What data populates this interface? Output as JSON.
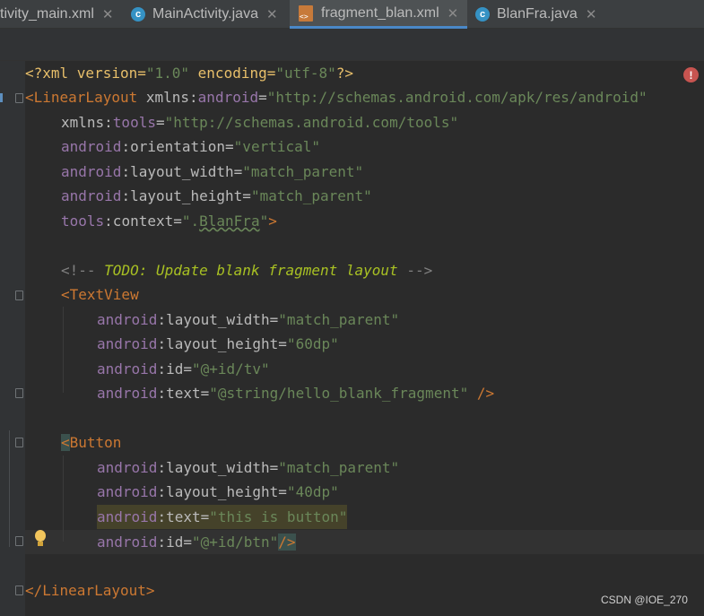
{
  "tabs": [
    {
      "label": "tivity_main.xml",
      "type": "xml",
      "active": false
    },
    {
      "label": "MainActivity.java",
      "type": "java",
      "active": false
    },
    {
      "label": "fragment_blan.xml",
      "type": "xml",
      "active": true
    },
    {
      "label": "BlanFra.java",
      "type": "java",
      "active": false
    }
  ],
  "tab_close_glyph": "✕",
  "java_icon_letter": "c",
  "code": {
    "l1": {
      "a": "<?xml version=",
      "b": "\"1.0\"",
      "c": " encoding=",
      "d": "\"utf-8\"",
      "e": "?>"
    },
    "l2": {
      "a": "<LinearLayout",
      "b": " xmlns:",
      "c": "android",
      "d": "=",
      "e": "\"http://schemas.android.com/apk/res/android\""
    },
    "l3": {
      "a": "xmlns:",
      "b": "tools",
      "c": "=",
      "d": "\"http://schemas.android.com/tools\""
    },
    "l4": {
      "a": "android",
      "b": ":orientation=",
      "c": "\"vertical\""
    },
    "l5": {
      "a": "android",
      "b": ":layout_width=",
      "c": "\"match_parent\""
    },
    "l6": {
      "a": "android",
      "b": ":layout_height=",
      "c": "\"match_parent\""
    },
    "l7": {
      "a": "tools",
      "b": ":context=",
      "c": "\".",
      "d": "BlanFra",
      "e": "\"",
      "f": ">"
    },
    "l9": {
      "a": "<!-- ",
      "b": "TODO: Update blank fragment layout",
      "c": " -->"
    },
    "l10": {
      "a": "<TextView"
    },
    "l11": {
      "a": "android",
      "b": ":layout_width=",
      "c": "\"match_parent\""
    },
    "l12": {
      "a": "android",
      "b": ":layout_height=",
      "c": "\"60dp\""
    },
    "l13": {
      "a": "android",
      "b": ":id=",
      "c": "\"@+id/tv\""
    },
    "l14": {
      "a": "android",
      "b": ":text=",
      "c": "\"@string/hello_blank_fragment\"",
      "d": " />"
    },
    "l16": {
      "a": "<",
      "b": "Button"
    },
    "l17": {
      "a": "android",
      "b": ":layout_width=",
      "c": "\"match_parent\""
    },
    "l18": {
      "a": "android",
      "b": ":layout_height=",
      "c": "\"40dp\""
    },
    "l19": {
      "a": "android",
      "b": ":text=",
      "c": "\"this is button\""
    },
    "l20": {
      "a": "android",
      "b": ":id=",
      "c": "\"@+id/btn\"",
      "d": "/>"
    },
    "l22": {
      "a": "</LinearLayout>"
    }
  },
  "inspection": {
    "error_glyph": "!"
  },
  "watermark": "CSDN @IOE_270",
  "colors": {
    "background": "#2b2b2b",
    "tag": "#cc7832",
    "namespace": "#9876aa",
    "string": "#6a8759",
    "comment": "#808080",
    "todo": "#a8c023",
    "error": "#c75450",
    "active_tab_underline": "#4a88c7"
  }
}
